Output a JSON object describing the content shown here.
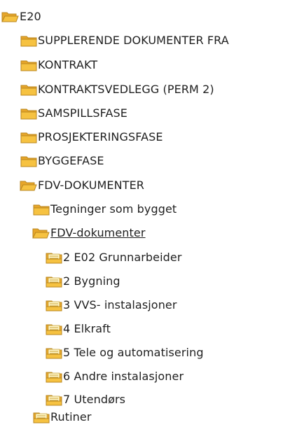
{
  "tree": {
    "nodes": [
      {
        "label": "E20",
        "icon": "folder-open-icon"
      },
      {
        "label": "SUPPLERENDE DOKUMENTER FRA",
        "icon": "folder-icon"
      },
      {
        "label": "KONTRAKT",
        "icon": "folder-icon"
      },
      {
        "label": "KONTRAKTSVEDLEGG (PERM 2)",
        "icon": "folder-icon"
      },
      {
        "label": "SAMSPILLSFASE",
        "icon": "folder-icon"
      },
      {
        "label": "PROSJEKTERINGSFASE",
        "icon": "folder-icon"
      },
      {
        "label": "BYGGEFASE",
        "icon": "folder-icon"
      },
      {
        "label": "FDV-DOKUMENTER",
        "icon": "folder-open-icon"
      },
      {
        "label": "Tegninger som bygget",
        "icon": "folder-icon"
      },
      {
        "label": "FDV-dokumenter",
        "icon": "folder-open-icon",
        "selected": true
      },
      {
        "label": "2 E02 Grunnarbeider",
        "icon": "document-folder-icon"
      },
      {
        "label": "2 Bygning",
        "icon": "document-folder-icon"
      },
      {
        "label": "3 VVS- instalasjoner",
        "icon": "document-folder-icon"
      },
      {
        "label": "4 Elkraft",
        "icon": "document-folder-icon"
      },
      {
        "label": "5 Tele og automatisering",
        "icon": "document-folder-icon"
      },
      {
        "label": "6 Andre instalasjoner",
        "icon": "document-folder-icon"
      },
      {
        "label": "7 Utendørs",
        "icon": "document-folder-icon"
      },
      {
        "label": "Rutiner",
        "icon": "document-folder-icon"
      }
    ]
  },
  "colors": {
    "folder_front": "#f6c241",
    "folder_back": "#e7a62a",
    "folder_outline": "#b8861f",
    "document_paper": "#fff6c8",
    "document_line": "#c9a33a",
    "text": "#1f1f1f"
  }
}
